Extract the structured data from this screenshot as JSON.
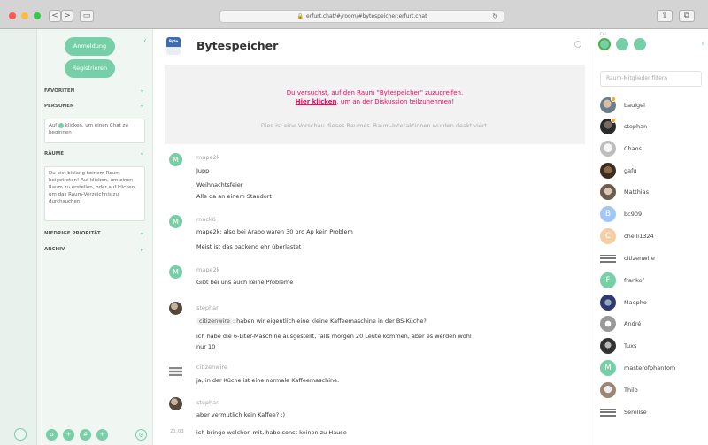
{
  "browser": {
    "url": "erfurt.chat/#/room/#bytespeicher:erfurt.chat",
    "back_label": "<",
    "forward_label": ">"
  },
  "left_panel": {
    "login_label": "Anmeldung",
    "register_label": "Registrieren",
    "sections": {
      "favorites": "FAVORITEN",
      "people": "PERSONEN",
      "rooms": "RÄUME",
      "low_priority": "NIEDRIGE PRIORITÄT",
      "archive": "ARCHIV"
    },
    "people_hint": [
      "Auf",
      "klicken, um einen Chat zu beginnen"
    ],
    "rooms_hint": "Du bist bislang keinem Raum beigetreten! Auf klicken, um einen Raum zu erstellen, oder auf klicken, um das Raum-Verzeichnis zu durchsuchen"
  },
  "room": {
    "title": "Bytespeicher",
    "avatar_text": "Byte",
    "preview_warning": "Du versuchst, auf den Raum \"Bytespeicher\" zuzugreifen.",
    "preview_link": "Hier klicken",
    "preview_link_suffix": ", um an der Diskussion teilzunehmen!",
    "preview_info": "Dies ist eine Vorschau dieses Raumes. Raum-Interaktionen wurden deaktiviert."
  },
  "messages": [
    {
      "sender": "mape2k",
      "avatar_letter": "M",
      "lines": [
        "Jupp",
        "Weihnachtsfeier",
        "Alle da an einem Standort"
      ]
    },
    {
      "sender": "mack6",
      "avatar_letter": "M",
      "lines": [
        "mape2k: also bei Arabo waren 30 pro Ap  kein Problem",
        "Meist ist das backend ehr überlastet"
      ]
    },
    {
      "sender": "mape2k",
      "avatar_letter": "M",
      "lines": [
        "Gibt bei uns auch keine Probleme"
      ]
    },
    {
      "sender": "stephan",
      "mention": "citizenwire",
      "lines": [
        ": haben wir eigentlich eine kleine Kaffeemaschine in der BS-Küche?",
        "ich habe die 6-Liter-Maschine ausgestellt, falls morgen 20 Leute kommen, aber es werden wohl",
        "nur 10"
      ]
    },
    {
      "sender": "citizenwire",
      "lines": [
        "ja, in der Küche ist eine normale Kaffeemaschine."
      ]
    },
    {
      "sender": "stephan",
      "lines": [
        "aber vermutlich kein Kaffee? :)"
      ]
    },
    {
      "time": "21:03",
      "lines": [
        "ich bringe welchen mit, habe sonst keinen zu Hause"
      ]
    }
  ],
  "members": {
    "filter_placeholder": "Raum-Mitglieder filtern",
    "top_label": "CAL",
    "list": [
      {
        "name": "bauigel"
      },
      {
        "name": "stephan"
      },
      {
        "name": "Chaos"
      },
      {
        "name": "gafu"
      },
      {
        "name": "Matthias"
      },
      {
        "name": "bc909",
        "letter": "B"
      },
      {
        "name": "chelli1324",
        "letter": "C"
      },
      {
        "name": "citizenwire"
      },
      {
        "name": "frankof",
        "letter": "F"
      },
      {
        "name": "Maepho"
      },
      {
        "name": "André"
      },
      {
        "name": "Tuxs"
      },
      {
        "name": "masterofphantom",
        "letter": "M"
      },
      {
        "name": "Thilo"
      },
      {
        "name": "Serellse"
      }
    ]
  }
}
